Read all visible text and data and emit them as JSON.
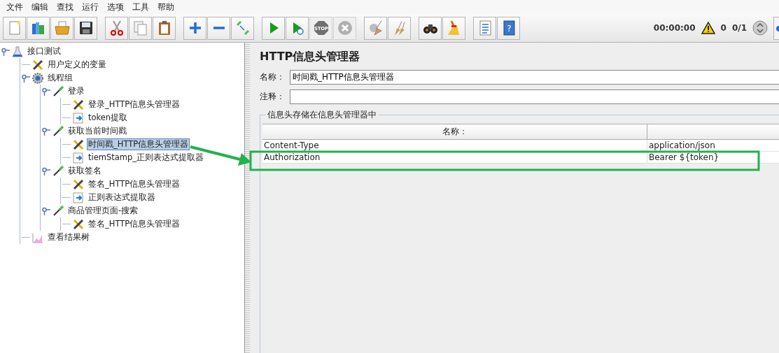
{
  "menu": [
    "文件",
    "编辑",
    "查找",
    "运行",
    "选项",
    "工具",
    "帮助"
  ],
  "toolbar": {
    "groups": [
      [
        {
          "kind": "new",
          "disabled": false
        },
        {
          "kind": "templates",
          "disabled": false
        },
        {
          "kind": "open",
          "disabled": false
        },
        {
          "kind": "save",
          "disabled": false
        }
      ],
      [
        {
          "kind": "cut",
          "disabled": false
        },
        {
          "kind": "copy",
          "disabled": false
        },
        {
          "kind": "paste",
          "disabled": false
        }
      ],
      [
        {
          "kind": "expand",
          "disabled": false
        },
        {
          "kind": "collapse",
          "disabled": false
        },
        {
          "kind": "toggle",
          "disabled": false
        }
      ],
      [
        {
          "kind": "start",
          "disabled": false
        },
        {
          "kind": "start-no-pause",
          "disabled": false
        },
        {
          "kind": "stop",
          "disabled": true,
          "label": "STOP"
        },
        {
          "kind": "shutdown",
          "disabled": true
        }
      ],
      [
        {
          "kind": "clear",
          "disabled": false
        },
        {
          "kind": "clear-all",
          "disabled": false
        }
      ],
      [
        {
          "kind": "search",
          "disabled": false
        },
        {
          "kind": "reset-search",
          "disabled": false
        }
      ],
      [
        {
          "kind": "function-helper",
          "disabled": false
        },
        {
          "kind": "help",
          "disabled": false,
          "label": "?"
        }
      ]
    ],
    "timer": "00:00:00",
    "warnings": "0",
    "threads": "0/1"
  },
  "tree": [
    {
      "label": "接口测试",
      "kind": "test-plan",
      "selected": false,
      "expanded": true,
      "children": [
        {
          "label": "用户定义的变量",
          "kind": "config",
          "selected": false
        },
        {
          "label": "线程组",
          "kind": "thread-group",
          "selected": false,
          "expanded": true,
          "children": [
            {
              "label": "登录",
              "kind": "sampler",
              "selected": false,
              "expanded": true,
              "children": [
                {
                  "label": "登录_HTTP信息头管理器",
                  "kind": "config",
                  "selected": false
                },
                {
                  "label": "token提取",
                  "kind": "extractor",
                  "selected": false
                }
              ]
            },
            {
              "label": "获取当前时间戳",
              "kind": "sampler",
              "selected": false,
              "expanded": true,
              "children": [
                {
                  "label": "时间戳_HTTP信息头管理器",
                  "kind": "config",
                  "selected": true
                },
                {
                  "label": "tiemStamp_正则表达式提取器",
                  "kind": "extractor",
                  "selected": false
                }
              ]
            },
            {
              "label": "获取签名",
              "kind": "sampler",
              "selected": false,
              "expanded": true,
              "children": [
                {
                  "label": "签名_HTTP信息头管理器",
                  "kind": "config",
                  "selected": false
                },
                {
                  "label": "正则表达式提取器",
                  "kind": "extractor",
                  "selected": false
                }
              ]
            },
            {
              "label": "商品管理页面-搜索",
              "kind": "sampler",
              "selected": false,
              "expanded": true,
              "children": [
                {
                  "label": "签名_HTTP信息头管理器",
                  "kind": "config",
                  "selected": false
                }
              ]
            }
          ]
        },
        {
          "label": "查看结果树",
          "kind": "listener",
          "selected": false
        }
      ]
    }
  ],
  "panel": {
    "title": "HTTP信息头管理器",
    "name_label": "名称：",
    "name_value": "时间戳_HTTP信息头管理器",
    "comment_label": "注释：",
    "group_title": "信息头存储在信息头管理器中",
    "table": {
      "columns": [
        "名称："
      ],
      "rows": [
        {
          "name": "Content-Type",
          "value": "application/json",
          "selected": false
        },
        {
          "name": "Authorization",
          "value": "Bearer ${token}",
          "selected": false
        }
      ]
    }
  }
}
